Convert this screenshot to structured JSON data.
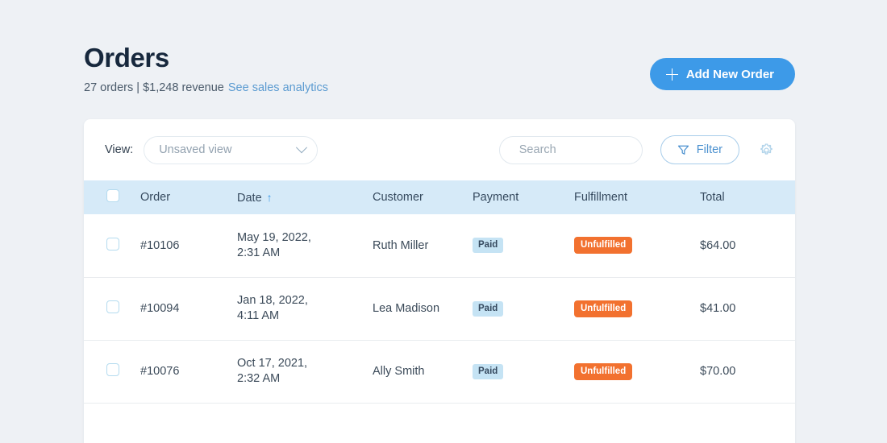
{
  "header": {
    "title": "Orders",
    "subtitle_meta": "27 orders | $1,248 revenue",
    "subtitle_link": "See sales analytics",
    "add_button_label": "Add New Order",
    "add_button_icon": "plus-icon"
  },
  "toolbar": {
    "view_label": "View:",
    "view_value": "Unsaved view",
    "view_chevron_icon": "chevron-down-icon",
    "search_placeholder": "Search",
    "search_value": "",
    "search_icon": "search-icon",
    "filter_label": "Filter",
    "filter_icon": "funnel-icon",
    "settings_icon": "gear-icon"
  },
  "table": {
    "columns": [
      {
        "key": "select",
        "label": ""
      },
      {
        "key": "order",
        "label": "Order"
      },
      {
        "key": "date",
        "label": "Date"
      },
      {
        "key": "customer",
        "label": "Customer"
      },
      {
        "key": "payment",
        "label": "Payment"
      },
      {
        "key": "fulfillment",
        "label": "Fulfillment"
      },
      {
        "key": "total",
        "label": "Total"
      }
    ],
    "sort": {
      "column": "Date",
      "direction": "asc",
      "glyph": "↑"
    },
    "rows": [
      {
        "order": "#10106",
        "date_line1": "May 19, 2022,",
        "date_line2": "2:31 AM",
        "customer": "Ruth Miller",
        "payment": "Paid",
        "fulfillment": "Unfulfilled",
        "total": "$64.00"
      },
      {
        "order": "#10094",
        "date_line1": "Jan 18, 2022,",
        "date_line2": "4:11 AM",
        "customer": "Lea Madison",
        "payment": "Paid",
        "fulfillment": "Unfulfilled",
        "total": "$41.00"
      },
      {
        "order": "#10076",
        "date_line1": "Oct 17, 2021,",
        "date_line2": "2:32 AM",
        "customer": "Ally Smith",
        "payment": "Paid",
        "fulfillment": "Unfulfilled",
        "total": "$70.00"
      }
    ]
  },
  "colors": {
    "page_background": "#eef1f5",
    "accent_blue": "#3d9ae8",
    "title_navy": "#17283d",
    "header_band": "#d6eaf8",
    "badge_paid_bg": "#c5e3f4",
    "badge_unfulfilled_bg": "#f2712f",
    "link_blue": "#5b9bd1"
  }
}
